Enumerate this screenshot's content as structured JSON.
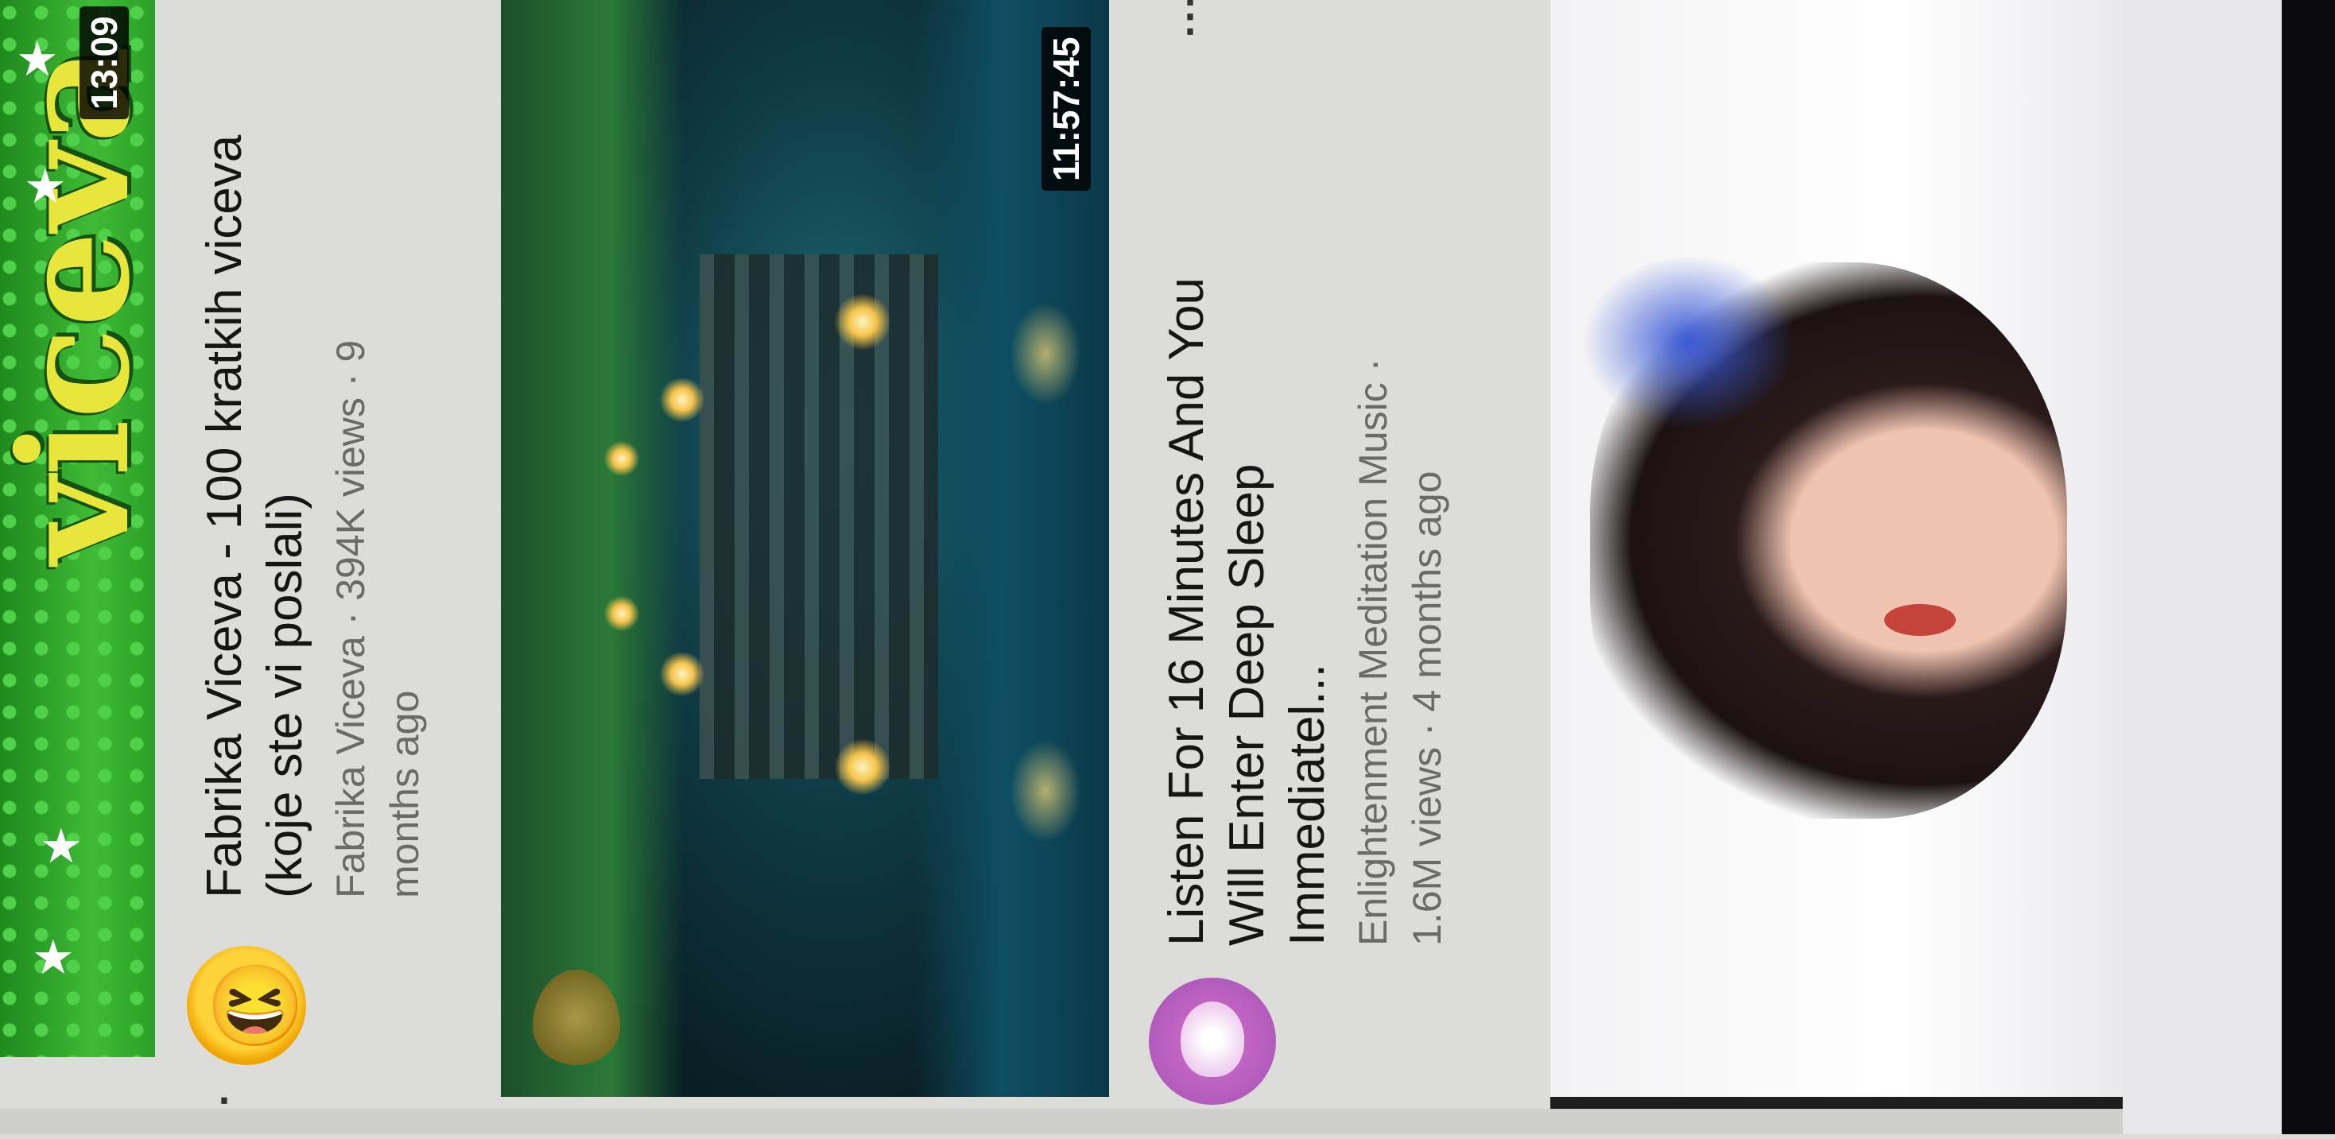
{
  "feed": {
    "items": [
      {
        "title": "Fabrika Viceva - 100 kratkih viceva (koje ste vi poslali)",
        "meta": "Fabrika Viceva · 394K views · 9 months ago",
        "duration": "13:09",
        "thumbnail_text": "viceva",
        "channel_avatar": "laughing-emoji"
      },
      {
        "title": "Listen For 16 Minutes And You Will Enter Deep Sleep Immediatel...",
        "meta": "Enlightenment Meditation Music · 1.6M views · 4 months ago",
        "duration": "11:57:45",
        "channel_avatar": "tree-logo"
      },
      {
        "thumbnail": "woman-portrait"
      }
    ],
    "menu_icon": "more-vert-icon"
  }
}
